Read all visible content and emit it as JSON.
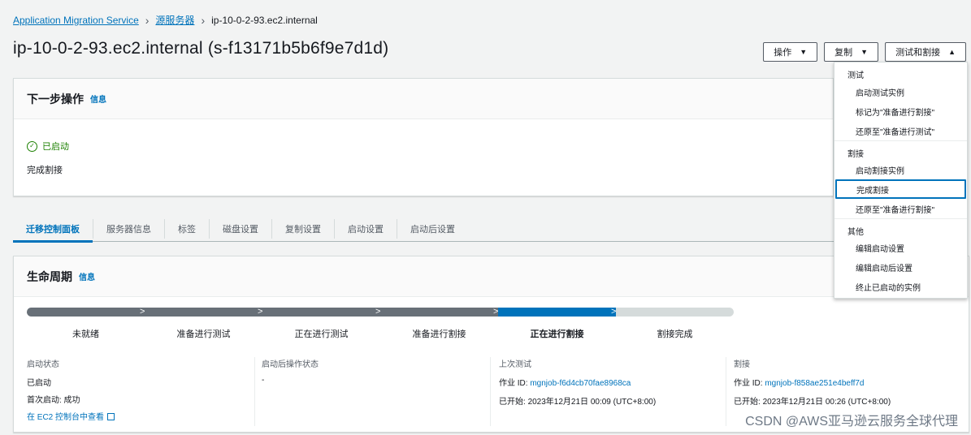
{
  "breadcrumb": {
    "items": [
      "Application Migration Service",
      "源服务器"
    ],
    "current": "ip-10-0-2-93.ec2.internal"
  },
  "page": {
    "title": "ip-10-0-2-93.ec2.internal (s-f13171b5b6f9e7d1d)"
  },
  "header_buttons": {
    "actions": "操作",
    "replicate": "复制",
    "test_cutover": "测试和割接"
  },
  "next_step": {
    "title": "下一步操作",
    "info": "信息",
    "status": "已启动",
    "description": "完成割接"
  },
  "tabs": [
    "迁移控制面板",
    "服务器信息",
    "标签",
    "磁盘设置",
    "复制设置",
    "启动设置",
    "启动后设置"
  ],
  "lifecycle": {
    "title": "生命周期",
    "info": "信息",
    "steps": [
      "未就绪",
      "准备进行测试",
      "正在进行测试",
      "准备进行割接",
      "正在进行割接",
      "割接完成"
    ],
    "current_index": 4,
    "colors": {
      "done": "#687078",
      "current": "#0073bb",
      "pending": "#d5dbdb"
    }
  },
  "details": {
    "launch_status_title": "启动状态",
    "launch_status_value": "已启动",
    "first_launch": "首次启动: 成功",
    "ec2_link": "在 EC2 控制台中查看",
    "post_launch_title": "启动后操作状态",
    "post_launch_value": "-",
    "last_test_title": "上次测试",
    "last_test_job_label": "作业 ID:",
    "last_test_job_id": "mgnjob-f6d4cb70fae8968ca",
    "last_test_started_label": "已开始:",
    "last_test_started": "2023年12月21日 00:09 (UTC+8:00)",
    "cutover_title": "割接",
    "cutover_job_label": "作业 ID:",
    "cutover_job_id": "mgnjob-f858ae251e4beff7d",
    "cutover_started_label": "已开始:",
    "cutover_started": "2023年12月21日 00:26 (UTC+8:00)"
  },
  "dropdown": {
    "group_test": "测试",
    "launch_test": "启动测试实例",
    "mark_ready_cutover": "标记为\"准备进行割接\"",
    "revert_ready_test": "还原至\"准备进行测试\"",
    "group_cutover": "割接",
    "launch_cutover": "启动割接实例",
    "finalize_cutover": "完成割接",
    "revert_ready_cutover": "还原至\"准备进行割接\"",
    "group_other": "其他",
    "edit_launch": "编辑启动设置",
    "edit_post_launch": "编辑启动后设置",
    "terminate_launched": "终止已启动的实例"
  },
  "watermark": "CSDN @AWS亚马逊云服务全球代理"
}
